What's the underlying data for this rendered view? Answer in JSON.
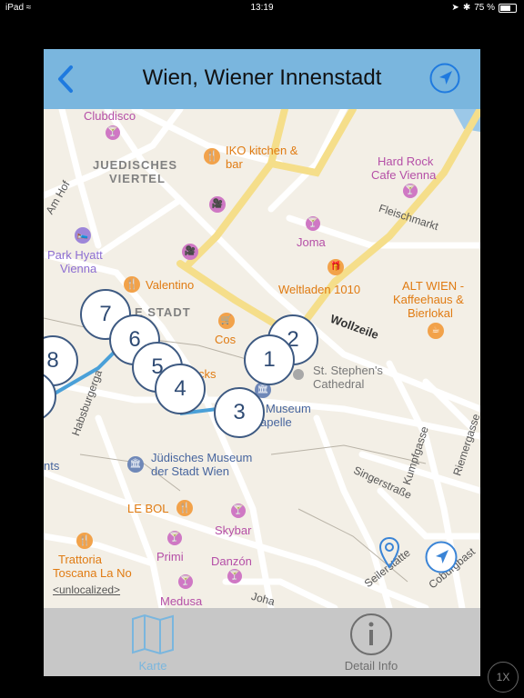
{
  "status_bar": {
    "device": "iPad",
    "time": "13:19",
    "battery": "75 %",
    "battery_level": 0.75
  },
  "navbar": {
    "title": "Wien, Wiener Innenstadt",
    "back_icon": "chevron-left-icon",
    "location_icon": "location-arrow-icon"
  },
  "map": {
    "labels": {
      "clubdisco": "Clubdisco",
      "juedisches_1": "JUEDISCHES",
      "juedisches_2": "VIERTEL",
      "iko_1": "IKO kitchen &",
      "iko_2": "bar",
      "hard_rock_1": "Hard Rock",
      "hard_rock_2": "Cafe Vienna",
      "am_hof": "Am Hof",
      "fleischmarkt": "Fleischmarkt",
      "joma": "Joma",
      "park_hyatt_1": "Park Hyatt",
      "park_hyatt_2": "Vienna",
      "valentino": "Valentino",
      "weltladen": "Weltladen 1010",
      "alt_wien_1": "ALT WIEN -",
      "alt_wien_2": "Kaffeehaus &",
      "alt_wien_3": "Bierlokal",
      "stadt": "E STADT",
      "cos": "Cos",
      "wollzeile": "Wollzeile",
      "cathedral_1": "St. Stephen's",
      "cathedral_2": "Cathedral",
      "cks": "cks",
      "habsburgergasse": "Habsburgerga",
      "museum_1": "Museum",
      "museum_2": "apelle",
      "kumpfgasse": "Kumpfgasse",
      "riemergasse": "Riemergasse",
      "nts": "nts",
      "juedisches_museum_1": "Jüdisches Museum",
      "juedisches_museum_2": "der Stadt Wien",
      "singerstrasse": "Singerstraße",
      "le_bol": "LE BOL",
      "skybar": "Skybar",
      "primi": "Primi",
      "trattoria_1": "Trattoria",
      "trattoria_2": "Toscana La No",
      "danzon": "Danzón",
      "seilerstaette": "Seilerstätte",
      "coburgbast": "Coburgbast",
      "unlocalized": "<unlocalized>",
      "medusa": "Medusa",
      "joha": "Joha"
    },
    "markers": [
      "1",
      "2",
      "3",
      "4",
      "5",
      "6",
      "7",
      "8"
    ]
  },
  "tabbar": {
    "tabs": [
      {
        "label": "Karte",
        "icon": "map-icon",
        "selected": true
      },
      {
        "label": "Detail Info",
        "icon": "info-icon",
        "selected": false
      }
    ]
  },
  "zoom_button": "1X",
  "colors": {
    "navbar": "#7ab6de",
    "accent": "#1f7adf",
    "map_bg": "#f3efe6",
    "marker_border": "#3e5a82"
  }
}
